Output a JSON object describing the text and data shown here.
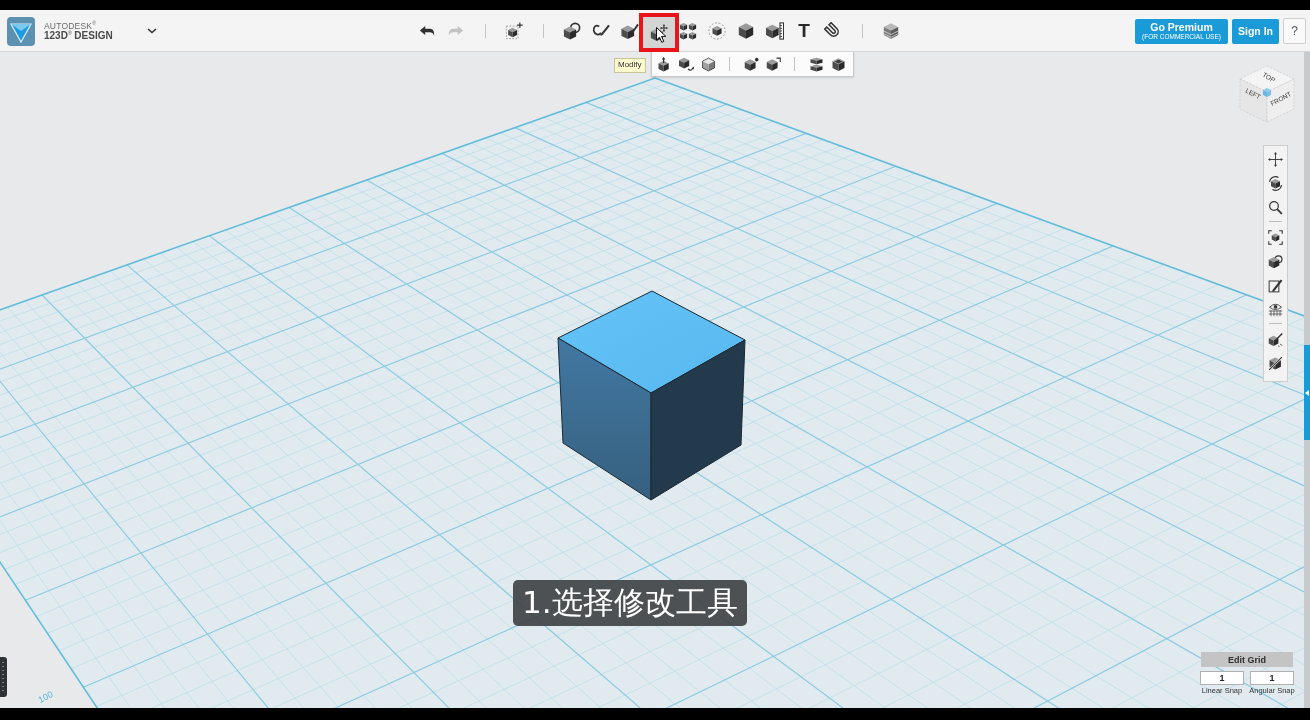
{
  "header": {
    "brand": {
      "company": "AUTODESK$^{®}$",
      "product": "123D$^{®}$ DESIGN"
    },
    "history": [
      {
        "kind": "undo",
        "disabled": false
      },
      {
        "kind": "redo",
        "disabled": true
      }
    ],
    "toolbar": {
      "groups": [
        {
          "tools": [
            {
              "kind": "transform",
              "selected": false
            }
          ]
        },
        {
          "tools": [
            {
              "kind": "primitives",
              "selected": false
            },
            {
              "kind": "sketch",
              "selected": false
            },
            {
              "kind": "construct",
              "selected": false
            },
            {
              "kind": "modify",
              "selected": true
            },
            {
              "kind": "pattern",
              "selected": false
            },
            {
              "kind": "group",
              "selected": false
            },
            {
              "kind": "combine",
              "selected": false
            },
            {
              "kind": "measure",
              "selected": false
            },
            {
              "kind": "text",
              "glyph": "T",
              "selected": false
            },
            {
              "kind": "snap",
              "selected": false
            }
          ]
        },
        {
          "tools": [
            {
              "kind": "material",
              "selected": false
            }
          ]
        }
      ]
    },
    "account": {
      "premium": {
        "label": "Go Premium",
        "note": "(FOR COMMERCIAL USE)"
      },
      "sign_in": "Sign In",
      "help": "?"
    }
  },
  "tooltip": "Modify",
  "modify_menu": {
    "groups": [
      [
        {
          "kind": "press-pull"
        },
        {
          "kind": "tweak"
        },
        {
          "kind": "split-face"
        }
      ],
      [
        {
          "kind": "fillet"
        },
        {
          "kind": "chamfer"
        }
      ],
      [
        {
          "kind": "split-solid"
        },
        {
          "kind": "shell"
        }
      ]
    ]
  },
  "viewport": {
    "view_cube": {
      "top": "TOP",
      "left": "LEFT",
      "front": "FRONT"
    },
    "nav_tools": {
      "groups": [
        [
          {
            "kind": "pan"
          },
          {
            "kind": "orbit"
          },
          {
            "kind": "zoom"
          }
        ],
        [
          {
            "kind": "fit"
          },
          {
            "kind": "views"
          },
          {
            "kind": "sketch-visibility"
          },
          {
            "kind": "grid-visibility"
          }
        ],
        [
          {
            "kind": "snap-edit"
          },
          {
            "kind": "hide"
          }
        ]
      ]
    },
    "grid": {
      "label": "100"
    },
    "caption": "1.选择修改工具",
    "edit_grid": {
      "title": "Edit Grid",
      "fields": [
        {
          "label": "Linear Snap",
          "value": "1"
        },
        {
          "label": "Angular Snap",
          "value": "1"
        }
      ]
    }
  }
}
